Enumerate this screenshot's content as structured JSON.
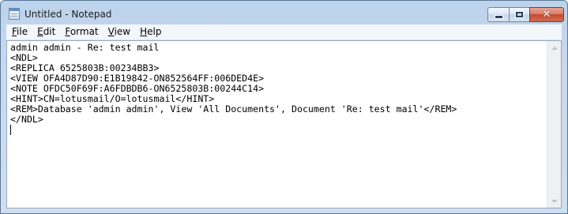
{
  "window": {
    "title": "Untitled - Notepad",
    "icon": "notepad-icon",
    "caption_icons": {
      "minimize": "minimize-icon",
      "maximize": "maximize-icon",
      "close": "close-icon",
      "close_glyph": "✕"
    }
  },
  "menu": {
    "items": [
      {
        "label": "File",
        "accel": "F",
        "rest": "ile"
      },
      {
        "label": "Edit",
        "accel": "E",
        "rest": "dit"
      },
      {
        "label": "Format",
        "accel": "F",
        "rest": "ormat"
      },
      {
        "label": "View",
        "accel": "V",
        "rest": "iew"
      },
      {
        "label": "Help",
        "accel": "H",
        "rest": "elp"
      }
    ]
  },
  "editor": {
    "lines": [
      "admin admin - Re: test mail",
      "<NDL>",
      "<REPLICA 6525803B:00234BB3>",
      "<VIEW OFA4D87D90:E1B19842-ON852564FF:006DED4E>",
      "<NOTE OFDC50F69F:A6FDBDB6-ON6525803B:00244C14>",
      "<HINT>CN=lotusmail/O=lotusmail</HINT>",
      "<REM>Database 'admin admin', View 'All Documents', Document 'Re: test mail'</REM>",
      "</NDL>"
    ]
  },
  "colors": {
    "title_frame": "#c7d9ee",
    "close_button": "#c24a32",
    "editor_background": "#ffffff"
  }
}
